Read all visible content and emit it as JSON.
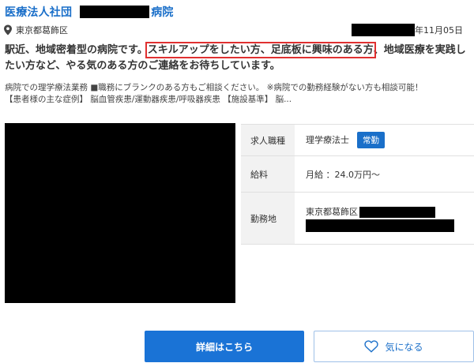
{
  "header": {
    "title_prefix": "医療法人社団",
    "title_suffix": "病院"
  },
  "location": {
    "icon": "map-pin-icon",
    "text": "東京都葛飾区"
  },
  "date": "年11月05日",
  "catchcopy": {
    "before": "駅近、地域密着型の病院です。",
    "highlight": "スキルアップをしたい方、足底板に興味のある方",
    "after": "、地域医療を実践したい方など、やる気のある方のご連絡をお待ちしています。"
  },
  "description": {
    "line1": "病院での理学療法業務 ■職務にブランクのある方もご相談ください。 ※病院での勤務経験がない方も相談可能！",
    "line2": "【患者様の主な症例】 脳血管疾患/運動器疾患/呼吸器疾患 【施設基準】 脳..."
  },
  "info": {
    "job_label": "求人職種",
    "job_value": "理学療法士",
    "employment_badge": "常勤",
    "salary_label": "給料",
    "salary_value": "月給 ：24.0万円〜",
    "workplace_label": "勤務地",
    "workplace_value": "東京都葛飾区"
  },
  "buttons": {
    "detail": "詳細はこちら",
    "favorite": "気になる",
    "favorite_icon": "heart-icon"
  },
  "colors": {
    "link_blue": "#1a6fc9",
    "button_blue": "#1a73d6",
    "highlight_red": "#e03030",
    "redaction": "#000000"
  }
}
